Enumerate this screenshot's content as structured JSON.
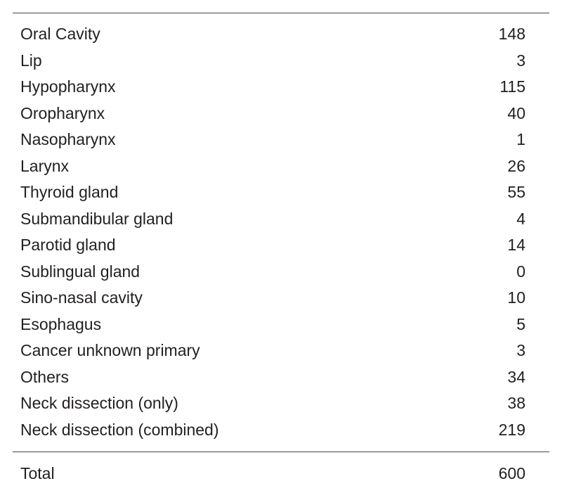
{
  "table": {
    "rows": [
      {
        "label": "Oral Cavity",
        "value": "148"
      },
      {
        "label": "Lip",
        "value": "3"
      },
      {
        "label": "Hypopharynx",
        "value": "115"
      },
      {
        "label": "Oropharynx",
        "value": "40"
      },
      {
        "label": "Nasopharynx",
        "value": "1"
      },
      {
        "label": "Larynx",
        "value": "26"
      },
      {
        "label": "Thyroid gland",
        "value": "55"
      },
      {
        "label": "Submandibular gland",
        "value": "4"
      },
      {
        "label": "Parotid gland",
        "value": "14"
      },
      {
        "label": "Sublingual gland",
        "value": "0"
      },
      {
        "label": "Sino-nasal cavity",
        "value": "10"
      },
      {
        "label": "Esophagus",
        "value": "5"
      },
      {
        "label": "Cancer unknown primary",
        "value": "3"
      },
      {
        "label": "Others",
        "value": "34"
      },
      {
        "label": "Neck dissection (only)",
        "value": "38"
      },
      {
        "label": "Neck dissection (combined)",
        "value": "219"
      }
    ],
    "total": {
      "label": "Total",
      "value": "600"
    }
  },
  "colors": {
    "text": "#231f20",
    "rule": "#4a4546"
  }
}
